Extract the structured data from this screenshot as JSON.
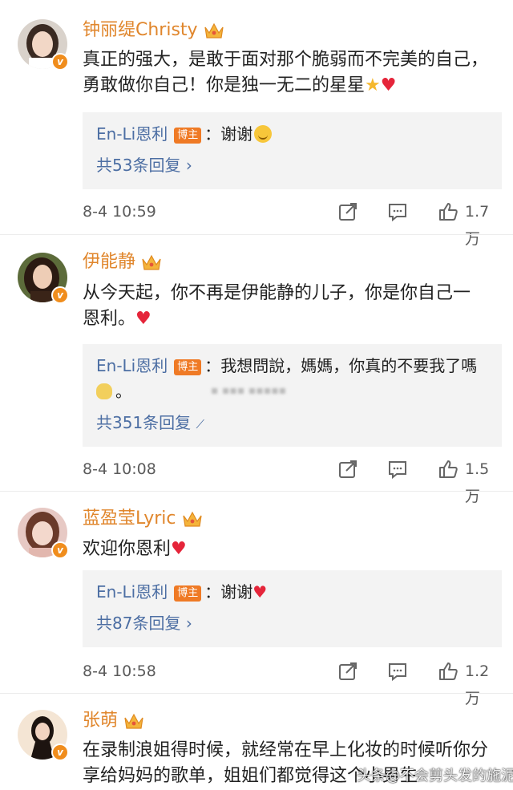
{
  "comments": [
    {
      "username": "钟丽缇Christy",
      "text": "真正的强大，是敢于面对那个脆弱而不完美的自己，勇敢做你自己！你是独一无二的星星",
      "text_emojis": [
        "star",
        "heart"
      ],
      "reply": {
        "author": "En-Li恩利",
        "tag": "博主",
        "text": "：谢谢",
        "emoji": "smile"
      },
      "reply_count": "共53条回复",
      "timestamp": "8-4 10:59",
      "likes": "1.7万",
      "avatar_colors": {
        "bg": "#d9d2cb",
        "hair": "#3a2a22",
        "face": "#f2d7c6"
      }
    },
    {
      "username": "伊能静",
      "text": "从今天起，你不再是伊能静的儿子，你是你自己一恩利。",
      "text_emojis": [
        "heart"
      ],
      "reply": {
        "author": "En-Li恩利",
        "tag": "博主",
        "text": "：我想問說，媽媽，你真的不要我了嗎",
        "text2": "。",
        "emoji": "blob"
      },
      "reply_count": "共351条回复",
      "timestamp": "8-4 10:08",
      "likes": "1.5万",
      "avatar_colors": {
        "bg": "#5c6b3a",
        "hair": "#2b1a12",
        "face": "#eecdb6"
      }
    },
    {
      "username": "蓝盈莹Lyric",
      "text": "欢迎你恩利",
      "text_emojis": [
        "heart"
      ],
      "reply": {
        "author": "En-Li恩利",
        "tag": "博主",
        "text": "：谢谢",
        "emoji": "heart"
      },
      "reply_count": "共87条回复",
      "timestamp": "8-4 10:58",
      "likes": "1.2万",
      "avatar_colors": {
        "bg": "#e7c9c4",
        "hair": "#6a3a2a",
        "face": "#f3d8cc"
      }
    },
    {
      "username": "张萌",
      "text": "在录制浪姐得时候，就经常在早上化妆的时候听你分享给妈妈的歌单，姐姐们都觉得这个小男生",
      "avatar_colors": {
        "bg": "#f4e5d4",
        "hair": "#1d1410",
        "face": "#f1d3c0"
      }
    }
  ],
  "watermark": "头条@不会剪头发的施泥",
  "colors": {
    "username": "#e0862c",
    "link": "#4c6ea3",
    "host_tag": "#ef7a25",
    "verified": "#f08d1d",
    "heart": "#e5253a",
    "reply_bg": "#f3f3f3",
    "meta": "#5b5b5b"
  },
  "icons": [
    "verified-badge-icon",
    "crown-icon",
    "share-icon",
    "comment-icon",
    "like-icon"
  ]
}
